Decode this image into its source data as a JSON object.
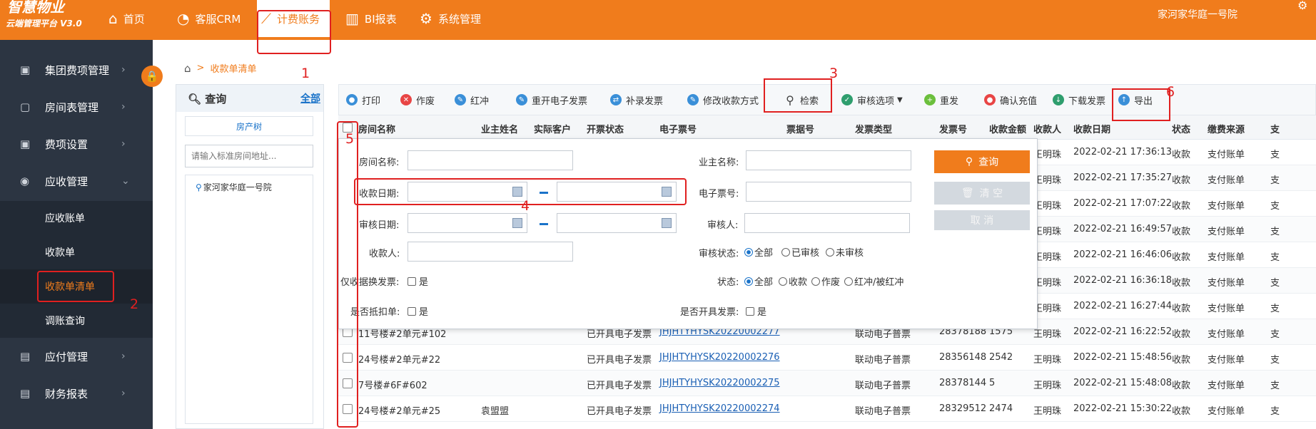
{
  "header": {
    "logo_title": "智慧物业",
    "logo_subtitle": "云端管理平台 V3.0",
    "nav": [
      {
        "label": "首页",
        "icon": "home-icon"
      },
      {
        "label": "客服CRM",
        "icon": "chart-pie-icon"
      },
      {
        "label": "计费账务",
        "icon": "line-chart-icon",
        "active": true
      },
      {
        "label": "BI报表",
        "icon": "bar-chart-icon"
      },
      {
        "label": "系统管理",
        "icon": "gear-icon"
      }
    ],
    "community": "家河家华庭一号院"
  },
  "sidebar": {
    "items": [
      {
        "label": "集团费项管理",
        "icon": "group-icon"
      },
      {
        "label": "房间表管理",
        "icon": "question-doc-icon"
      },
      {
        "label": "费项设置",
        "icon": "settings-icon"
      },
      {
        "label": "应收管理",
        "icon": "receivable-icon",
        "expanded": true
      },
      {
        "label": "应付管理",
        "icon": "payable-icon"
      },
      {
        "label": "财务报表",
        "icon": "report-icon"
      }
    ],
    "sub_items": [
      "应收账单",
      "收款单",
      "收款单清单",
      "调账查询"
    ],
    "active_sub": "收款单清单"
  },
  "breadcrumb": {
    "current": "收款单清单"
  },
  "left_panel": {
    "query_label": "查询",
    "all_label": "全部",
    "tab_label": "房产树",
    "search_placeholder": "请输入标准房间地址...",
    "tree_node": "家河家华庭一号院"
  },
  "toolbar": {
    "buttons": [
      {
        "label": "打印",
        "icon": "print-icon"
      },
      {
        "label": "作废",
        "icon": "cancel-icon"
      },
      {
        "label": "红冲",
        "icon": "pencil-icon"
      },
      {
        "label": "重开电子发票",
        "icon": "pencil-icon"
      },
      {
        "label": "补录发票",
        "icon": "shuffle-icon"
      },
      {
        "label": "修改收款方式",
        "icon": "pencil-icon"
      },
      {
        "label": "检索",
        "icon": "search-icon"
      },
      {
        "label": "审核选项",
        "icon": "check-icon"
      },
      {
        "label": "重发",
        "icon": "plus-icon"
      },
      {
        "label": "确认充值",
        "icon": "confirm-icon"
      },
      {
        "label": "下载发票",
        "icon": "download-icon"
      },
      {
        "label": "导出",
        "icon": "export-icon"
      }
    ]
  },
  "table": {
    "columns": [
      "房间名称",
      "业主姓名",
      "实际客户",
      "开票状态",
      "电子票号",
      "票据号",
      "发票类型",
      "发票号",
      "收款金额",
      "收款人",
      "收款日期",
      "状态",
      "缴费来源",
      "支"
    ],
    "rows": [
      {
        "room": "",
        "owner": "",
        "customer": "",
        "invoice_status": "",
        "e_ticket": "",
        "ticket_no": "",
        "invoice_type": "",
        "invoice_no": "",
        "amount": "",
        "payee": "王明珠",
        "date": "2022-02-21 17:36:13",
        "status": "收款",
        "source": "支付账单",
        "extra": "支"
      },
      {
        "room": "",
        "owner": "",
        "customer": "",
        "invoice_status": "",
        "e_ticket": "",
        "ticket_no": "",
        "invoice_type": "",
        "invoice_no": "",
        "amount": "",
        "payee": "王明珠",
        "date": "2022-02-21 17:35:27",
        "status": "收款",
        "source": "支付账单",
        "extra": "支"
      },
      {
        "room": "",
        "owner": "",
        "customer": "",
        "invoice_status": "",
        "e_ticket": "",
        "ticket_no": "",
        "invoice_type": "",
        "invoice_no": "",
        "amount": "",
        "payee": "王明珠",
        "date": "2022-02-21 17:07:22",
        "status": "收款",
        "source": "支付账单",
        "extra": "支"
      },
      {
        "room": "",
        "owner": "",
        "customer": "",
        "invoice_status": "",
        "e_ticket": "",
        "ticket_no": "",
        "invoice_type": "",
        "invoice_no": "",
        "amount": "",
        "payee": "王明珠",
        "date": "2022-02-21 16:49:57",
        "status": "收款",
        "source": "支付账单",
        "extra": "支"
      },
      {
        "room": "",
        "owner": "",
        "customer": "",
        "invoice_status": "",
        "e_ticket": "",
        "ticket_no": "",
        "invoice_type": "",
        "invoice_no": "",
        "amount": "",
        "payee": "王明珠",
        "date": "2022-02-21 16:46:06",
        "status": "收款",
        "source": "支付账单",
        "extra": "支"
      },
      {
        "room": "",
        "owner": "",
        "customer": "",
        "invoice_status": "",
        "e_ticket": "",
        "ticket_no": "",
        "invoice_type": "",
        "invoice_no": "",
        "amount": "",
        "payee": "王明珠",
        "date": "2022-02-21 16:36:18",
        "status": "收款",
        "source": "支付账单",
        "extra": "支"
      },
      {
        "room": "",
        "owner": "",
        "customer": "",
        "invoice_status": "",
        "e_ticket": "",
        "ticket_no": "",
        "invoice_type": "",
        "invoice_no": "",
        "amount": "",
        "payee": "王明珠",
        "date": "2022-02-21 16:27:44",
        "status": "收款",
        "source": "支付账单",
        "extra": "支"
      },
      {
        "room": "11号楼#2单元#102",
        "owner": "",
        "customer": "",
        "invoice_status": "已开具电子发票",
        "e_ticket": "JHJHTYHYSK20220002277",
        "ticket_no": "",
        "invoice_type": "联动电子普票",
        "invoice_no": "28378188",
        "amount": "1575",
        "payee": "王明珠",
        "date": "2022-02-21 16:22:52",
        "status": "收款",
        "source": "支付账单",
        "extra": "支"
      },
      {
        "room": "24号楼#2单元#22",
        "owner": "",
        "customer": "",
        "invoice_status": "已开具电子发票",
        "e_ticket": "JHJHTYHYSK20220002276",
        "ticket_no": "",
        "invoice_type": "联动电子普票",
        "invoice_no": "28356148",
        "amount": "2542",
        "payee": "王明珠",
        "date": "2022-02-21 15:48:56",
        "status": "收款",
        "source": "支付账单",
        "extra": "支"
      },
      {
        "room": "7号楼#6F#602",
        "owner": "",
        "customer": "",
        "invoice_status": "已开具电子发票",
        "e_ticket": "JHJHTYHYSK20220002275",
        "ticket_no": "",
        "invoice_type": "联动电子普票",
        "invoice_no": "28378144",
        "amount": "5",
        "payee": "王明珠",
        "date": "2022-02-21 15:48:08",
        "status": "收款",
        "source": "支付账单",
        "extra": "支"
      },
      {
        "room": "24号楼#2单元#25",
        "owner": "袁盟盟",
        "customer": "",
        "invoice_status": "已开具电子发票",
        "e_ticket": "JHJHTYHYSK20220002274",
        "ticket_no": "",
        "invoice_type": "联动电子普票",
        "invoice_no": "28329512",
        "amount": "2474",
        "payee": "王明珠",
        "date": "2022-02-21 15:30:22",
        "status": "收款",
        "source": "支付账单",
        "extra": "支"
      }
    ]
  },
  "search_panel": {
    "room_name": "房间名称:",
    "owner_name": "业主名称:",
    "pay_date": "收款日期:",
    "e_ticket": "电子票号:",
    "audit_date": "审核日期:",
    "auditor": "审核人:",
    "payee": "收款人:",
    "audit_status": "审核状态:",
    "audit_options": [
      "全部",
      "已审核",
      "未审核"
    ],
    "only_receipt": "仅收据换发票:",
    "yes": "是",
    "status": "状态:",
    "status_options": [
      "全部",
      "收款",
      "作废",
      "红冲/被红冲"
    ],
    "is_deduct": "是否抵扣单:",
    "is_invoiced": "是否开具发票:",
    "query_btn": "查询",
    "clear_btn": "清 空",
    "cancel_btn": "取 消"
  },
  "annotations": [
    "1",
    "2",
    "3",
    "4",
    "5",
    "6"
  ]
}
